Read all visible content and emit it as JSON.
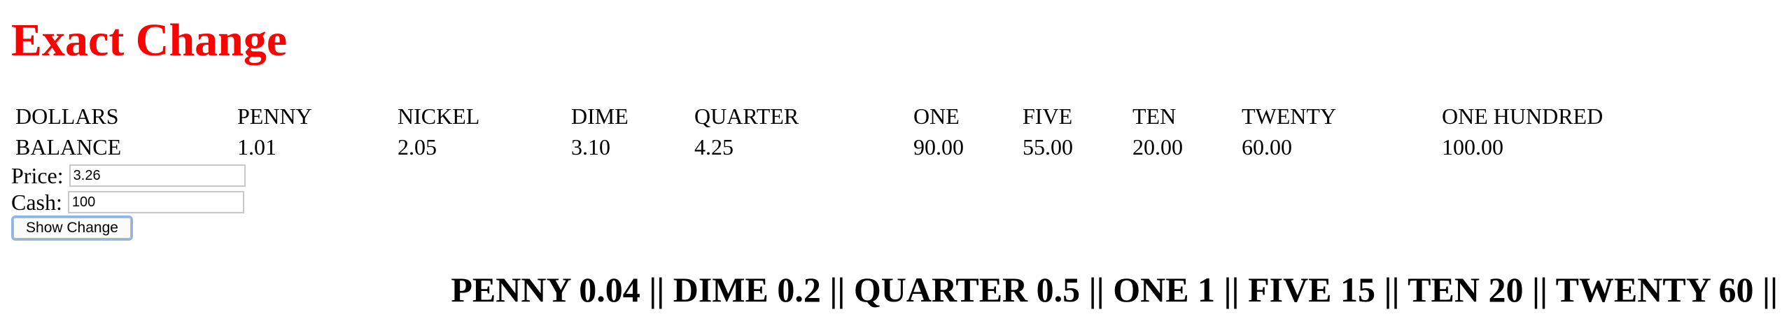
{
  "page": {
    "title": "Exact Change",
    "title_color": "#ff0000"
  },
  "table": {
    "headers": [
      "DOLLARS",
      "PENNY",
      "NICKEL",
      "DIME",
      "QUARTER",
      "ONE",
      "FIVE",
      "TEN",
      "TWENTY",
      "ONE HUNDRED"
    ],
    "balance": [
      "BALANCE",
      "1.01",
      "2.05",
      "3.10",
      "4.25",
      "90.00",
      "55.00",
      "20.00",
      "60.00",
      "100.00"
    ]
  },
  "form": {
    "price_label": "Price:",
    "price_value": "3.26",
    "cash_label": "Cash:",
    "cash_value": "100",
    "button_label": "Show Change"
  },
  "result": {
    "text": "PENNY 0.04 || DIME 0.2 || QUARTER 0.5 || ONE 1 || FIVE 15 || TEN 20 || TWENTY 60 ||"
  }
}
